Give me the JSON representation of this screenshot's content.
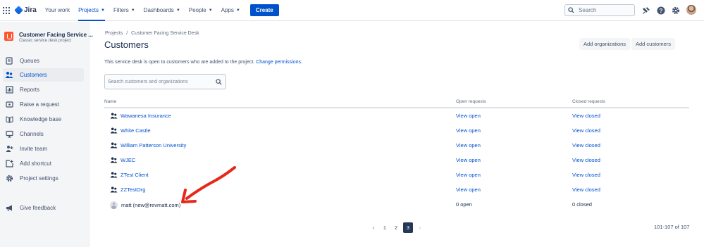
{
  "nav": {
    "brand": "Jira",
    "items": [
      {
        "label": "Your work",
        "chevron": false
      },
      {
        "label": "Projects",
        "chevron": true,
        "active": true
      },
      {
        "label": "Filters",
        "chevron": true
      },
      {
        "label": "Dashboards",
        "chevron": true
      },
      {
        "label": "People",
        "chevron": true
      },
      {
        "label": "Apps",
        "chevron": true
      }
    ],
    "create_label": "Create",
    "search_placeholder": "Search"
  },
  "project": {
    "name": "Customer Facing Service ...",
    "type": "Classic service desk project"
  },
  "sidebar": {
    "items": [
      {
        "label": "Queues",
        "icon": "queues-icon"
      },
      {
        "label": "Customers",
        "icon": "customers-icon",
        "active": true
      },
      {
        "label": "Reports",
        "icon": "reports-icon"
      },
      {
        "label": "Raise a request",
        "icon": "raise-request-icon"
      },
      {
        "label": "Knowledge base",
        "icon": "knowledge-base-icon"
      },
      {
        "label": "Channels",
        "icon": "channels-icon"
      },
      {
        "label": "Invite team",
        "icon": "invite-team-icon"
      },
      {
        "label": "Add shortcut",
        "icon": "add-shortcut-icon"
      },
      {
        "label": "Project settings",
        "icon": "gear-icon"
      }
    ],
    "feedback": "Give feedback"
  },
  "main": {
    "breadcrumb": {
      "root": "Projects",
      "sep": "/",
      "current": "Customer Facing Service Desk"
    },
    "title": "Customers",
    "add_org_label": "Add organizations",
    "add_customers_label": "Add customers",
    "info_text": "This service desk is open to customers who are added to the project.",
    "info_link": "Change permissions.",
    "filter_placeholder": "Search customers and organizations",
    "columns": {
      "name": "Name",
      "open": "Open requests",
      "closed": "Closed requests"
    },
    "rows": [
      {
        "name": "Wawanesa Insurance",
        "open": "View open",
        "closed": "View closed",
        "kind": "org"
      },
      {
        "name": "White Castle",
        "open": "View open",
        "closed": "View closed",
        "kind": "org"
      },
      {
        "name": "William Patterson University",
        "open": "View open",
        "closed": "View closed",
        "kind": "org"
      },
      {
        "name": "WJEC",
        "open": "View open",
        "closed": "View closed",
        "kind": "org"
      },
      {
        "name": "ZTest Client",
        "open": "View open",
        "closed": "View closed",
        "kind": "org"
      },
      {
        "name": "ZZTestOrg",
        "open": "View open",
        "closed": "View closed",
        "kind": "org"
      },
      {
        "name": "matt (new@revmatt.com)",
        "open": "0 open",
        "closed": "0 closed",
        "kind": "person"
      }
    ],
    "pagination": {
      "pages": [
        "1",
        "2",
        "3"
      ],
      "current": "3",
      "prev": "‹",
      "next": "›"
    },
    "count": "101-107 of 107"
  },
  "colors": {
    "accent": "#0052cc",
    "annotation_arrow": "#e8271b"
  }
}
